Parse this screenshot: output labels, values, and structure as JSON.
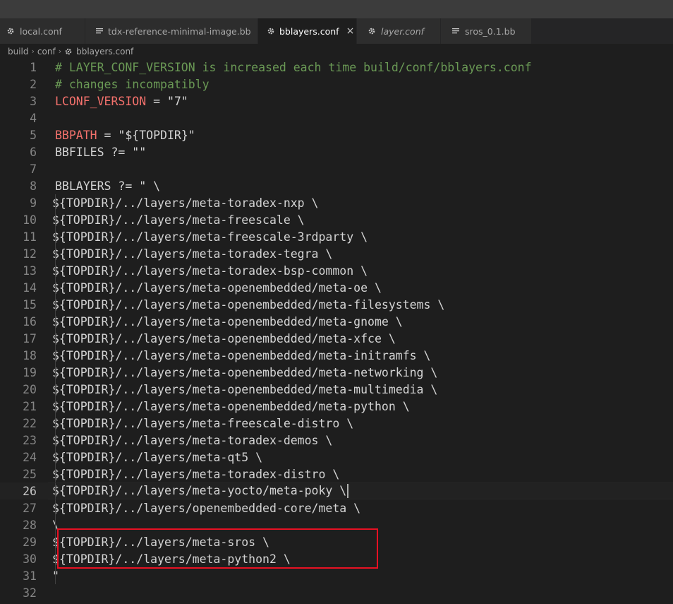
{
  "tabs": [
    {
      "label": "local.conf",
      "icon": "gear-icon",
      "active": false,
      "preview": false
    },
    {
      "label": "tdx-reference-minimal-image.bb",
      "icon": "lines-icon",
      "active": false,
      "preview": false
    },
    {
      "label": "bblayers.conf",
      "icon": "gear-icon",
      "active": true,
      "preview": false,
      "close": "×"
    },
    {
      "label": "layer.conf",
      "icon": "gear-icon",
      "active": false,
      "preview": true
    },
    {
      "label": "sros_0.1.bb",
      "icon": "lines-icon",
      "active": false,
      "preview": false
    }
  ],
  "breadcrumb": {
    "parts": [
      "build",
      "conf",
      "bblayers.conf"
    ],
    "separator": "›"
  },
  "editor": {
    "current_line": 26,
    "lines": [
      {
        "n": "1",
        "text": "# LAYER_CONF_VERSION is increased each time build/conf/bblayers.conf",
        "kind": "comment"
      },
      {
        "n": "2",
        "text": "# changes incompatibly",
        "kind": "comment"
      },
      {
        "n": "3",
        "var": "LCONF_VERSION",
        "rest": " = \"7\"",
        "kind": "assign"
      },
      {
        "n": "4",
        "text": "",
        "kind": "plain"
      },
      {
        "n": "5",
        "var": "BBPATH",
        "rest": " = \"${TOPDIR}\"",
        "kind": "assign"
      },
      {
        "n": "6",
        "text": "BBFILES ?= \"\"",
        "kind": "plain"
      },
      {
        "n": "7",
        "text": "",
        "kind": "plain"
      },
      {
        "n": "8",
        "text": "BBLAYERS ?= \" \\",
        "kind": "plain"
      },
      {
        "n": "9",
        "text": "${TOPDIR}/../layers/meta-toradex-nxp \\",
        "kind": "indent"
      },
      {
        "n": "10",
        "text": "${TOPDIR}/../layers/meta-freescale \\",
        "kind": "indent"
      },
      {
        "n": "11",
        "text": "${TOPDIR}/../layers/meta-freescale-3rdparty \\",
        "kind": "indent"
      },
      {
        "n": "12",
        "text": "${TOPDIR}/../layers/meta-toradex-tegra \\",
        "kind": "indent"
      },
      {
        "n": "13",
        "text": "${TOPDIR}/../layers/meta-toradex-bsp-common \\",
        "kind": "indent"
      },
      {
        "n": "14",
        "text": "${TOPDIR}/../layers/meta-openembedded/meta-oe \\",
        "kind": "indent"
      },
      {
        "n": "15",
        "text": "${TOPDIR}/../layers/meta-openembedded/meta-filesystems \\",
        "kind": "indent"
      },
      {
        "n": "16",
        "text": "${TOPDIR}/../layers/meta-openembedded/meta-gnome \\",
        "kind": "indent"
      },
      {
        "n": "17",
        "text": "${TOPDIR}/../layers/meta-openembedded/meta-xfce \\",
        "kind": "indent"
      },
      {
        "n": "18",
        "text": "${TOPDIR}/../layers/meta-openembedded/meta-initramfs \\",
        "kind": "indent"
      },
      {
        "n": "19",
        "text": "${TOPDIR}/../layers/meta-openembedded/meta-networking \\",
        "kind": "indent"
      },
      {
        "n": "20",
        "text": "${TOPDIR}/../layers/meta-openembedded/meta-multimedia \\",
        "kind": "indent"
      },
      {
        "n": "21",
        "text": "${TOPDIR}/../layers/meta-openembedded/meta-python \\",
        "kind": "indent"
      },
      {
        "n": "22",
        "text": "${TOPDIR}/../layers/meta-freescale-distro \\",
        "kind": "indent"
      },
      {
        "n": "23",
        "text": "${TOPDIR}/../layers/meta-toradex-demos \\",
        "kind": "indent"
      },
      {
        "n": "24",
        "text": "${TOPDIR}/../layers/meta-qt5 \\",
        "kind": "indent"
      },
      {
        "n": "25",
        "text": "${TOPDIR}/../layers/meta-toradex-distro \\",
        "kind": "indent"
      },
      {
        "n": "26",
        "text": "${TOPDIR}/../layers/meta-yocto/meta-poky \\",
        "kind": "indent"
      },
      {
        "n": "27",
        "text": "${TOPDIR}/../layers/openembedded-core/meta \\",
        "kind": "indent"
      },
      {
        "n": "28",
        "text": "\\",
        "kind": "indent"
      },
      {
        "n": "29",
        "text": "${TOPDIR}/../layers/meta-sros \\",
        "kind": "indent"
      },
      {
        "n": "30",
        "text": "${TOPDIR}/../layers/meta-python2 \\",
        "kind": "indent"
      },
      {
        "n": "31",
        "text": "\"",
        "kind": "indent"
      },
      {
        "n": "32",
        "text": "",
        "kind": "plain"
      }
    ]
  },
  "annotation": {
    "color": "#e81123",
    "lines": [
      "29",
      "30"
    ]
  }
}
